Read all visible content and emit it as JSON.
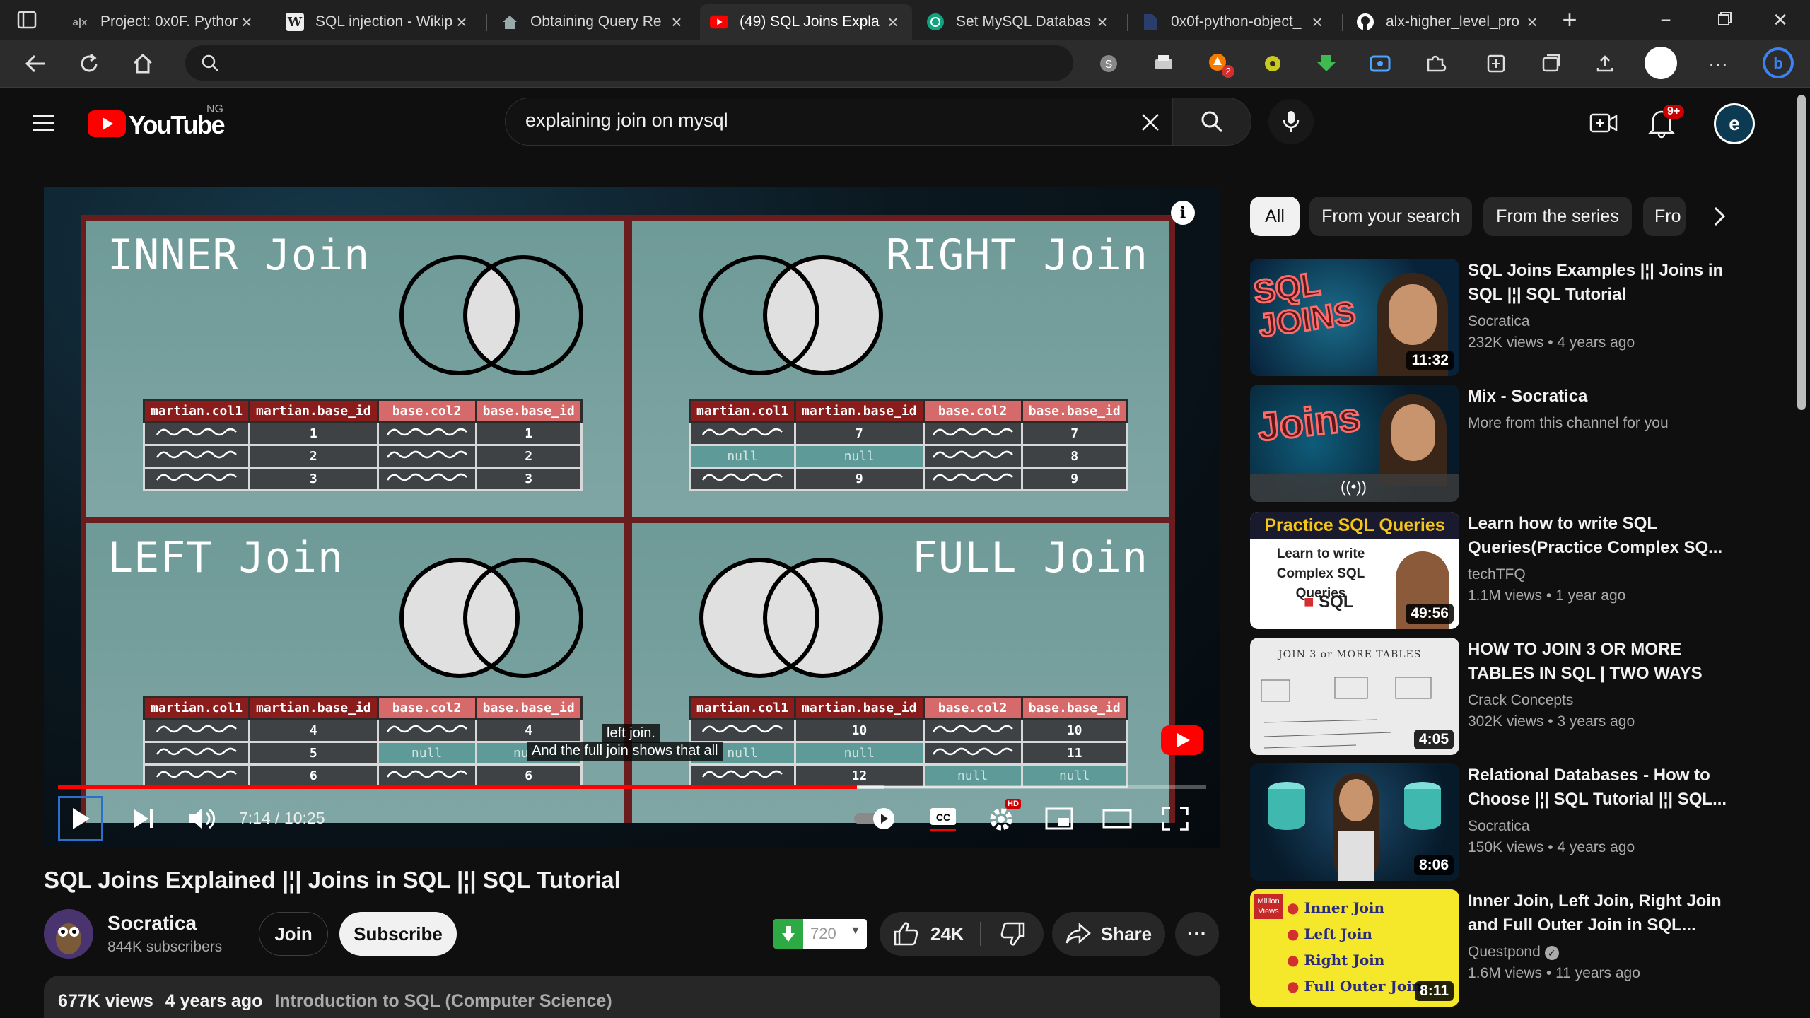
{
  "browser": {
    "tabs": [
      {
        "title": "Project: 0x0F. Python",
        "favicon": "alx"
      },
      {
        "title": "SQL injection - Wikip",
        "favicon": "W"
      },
      {
        "title": "Obtaining Query Re",
        "favicon": "house"
      },
      {
        "title": "(49) SQL Joins Expla",
        "favicon": "youtube"
      },
      {
        "title": "Set MySQL Databas",
        "favicon": "openai"
      },
      {
        "title": "0x0f-python-object_",
        "favicon": "blank"
      },
      {
        "title": "alx-higher_level_pro",
        "favicon": "github"
      }
    ],
    "ext_badge": "2"
  },
  "youtube": {
    "logo_text": "YouTube",
    "region": "NG",
    "search_value": "explaining join on mysql",
    "notif_badge": "9+"
  },
  "video": {
    "quad_titles": [
      "INNER Join",
      "RIGHT Join",
      "LEFT Join",
      "FULL Join"
    ],
    "table_headers": [
      "martian.col1",
      "martian.base_id",
      "base.col2",
      "base.base_id"
    ],
    "inner_rows": [
      [
        "1",
        "1"
      ],
      [
        "2",
        "2"
      ],
      [
        "3",
        "3"
      ]
    ],
    "right_rows": [
      [
        "7",
        "7"
      ],
      [
        "null",
        "8"
      ],
      [
        "9",
        "9"
      ]
    ],
    "left_rows": [
      [
        "4",
        "4"
      ],
      [
        "5",
        "null"
      ],
      [
        "6",
        "6"
      ]
    ],
    "full_rows": [
      [
        "10",
        "10"
      ],
      [
        "null",
        "11"
      ],
      [
        "12",
        "null"
      ]
    ],
    "null_text": "null",
    "subtitle_line1": "left join.",
    "subtitle_line2": "And the full join shows that all",
    "time": "7:14 / 10:25",
    "progress": 0.696,
    "hd_badge": "HD"
  },
  "meta": {
    "title": "SQL Joins Explained |¦| Joins in SQL |¦| SQL Tutorial",
    "channel": "Socratica",
    "subscribers": "844K subscribers",
    "join_label": "Join",
    "subscribe_label": "Subscribe",
    "dislike_count": "720",
    "likes": "24K",
    "share_label": "Share",
    "views": "677K views",
    "age": "4 years ago",
    "playlist": "Introduction to SQL (Computer Science)"
  },
  "chips": [
    "All",
    "From your search",
    "From the series",
    "Fro"
  ],
  "recommendations": [
    {
      "title": "SQL Joins Examples |¦| Joins in SQL |¦| SQL Tutorial",
      "channel": "Socratica",
      "views": "232K views",
      "age": "4 years ago",
      "duration": "11:32",
      "thumb_text": "SQL JOINS"
    },
    {
      "title": "Mix - Socratica",
      "channel": "More from this channel for you",
      "views": "",
      "age": "",
      "duration": "",
      "thumb_text": "Joins"
    },
    {
      "title": "Learn how to write SQL Queries(Practice Complex SQ...",
      "channel": "techTFQ",
      "views": "1.1M views",
      "age": "1 year ago",
      "duration": "49:56",
      "thumb_text": "Practice SQL Queries",
      "thumb_sub": "Learn to write Complex SQL Queries",
      "thumb_sql": "SQL"
    },
    {
      "title": "HOW TO JOIN 3 OR MORE TABLES IN SQL | TWO WAYS",
      "channel": "Crack Concepts",
      "views": "302K views",
      "age": "3 years ago",
      "duration": "4:05",
      "thumb_text": "JOIN 3 or MORE TABLES"
    },
    {
      "title": "Relational Databases - How to Choose |¦| SQL Tutorial |¦| SQL...",
      "channel": "Socratica",
      "views": "150K views",
      "age": "4 years ago",
      "duration": "8:06",
      "thumb_text": ""
    },
    {
      "title": "Inner Join, Left Join, Right Join and Full Outer Join in SQL...",
      "channel": "Questpond",
      "views": "1.6M views",
      "age": "11 years ago",
      "duration": "8:11",
      "thumb_items": [
        "Inner Join",
        "Left Join",
        "Right Join",
        "Full Outer Join"
      ],
      "thumb_badge": "Million Views"
    }
  ]
}
